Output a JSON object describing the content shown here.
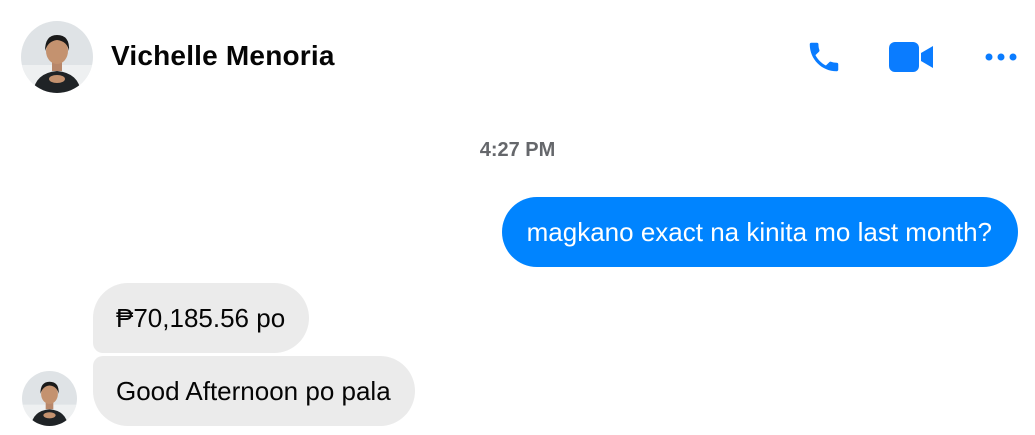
{
  "header": {
    "contact_name": "Vichelle Menoria",
    "actions": {
      "call_icon": "phone-icon",
      "video_icon": "video-camera-icon",
      "more_icon": "more-dots-icon"
    }
  },
  "conversation": {
    "timestamp": "4:27 PM",
    "messages": [
      {
        "direction": "outgoing",
        "text": "magkano exact na kinita mo last month?"
      },
      {
        "direction": "incoming",
        "text": "₱70,185.56 po"
      },
      {
        "direction": "incoming",
        "text": "Good Afternoon po pala"
      }
    ]
  },
  "colors": {
    "accent": "#0084ff",
    "incoming_bubble": "#ebebeb",
    "timestamp_text": "#65676b"
  }
}
